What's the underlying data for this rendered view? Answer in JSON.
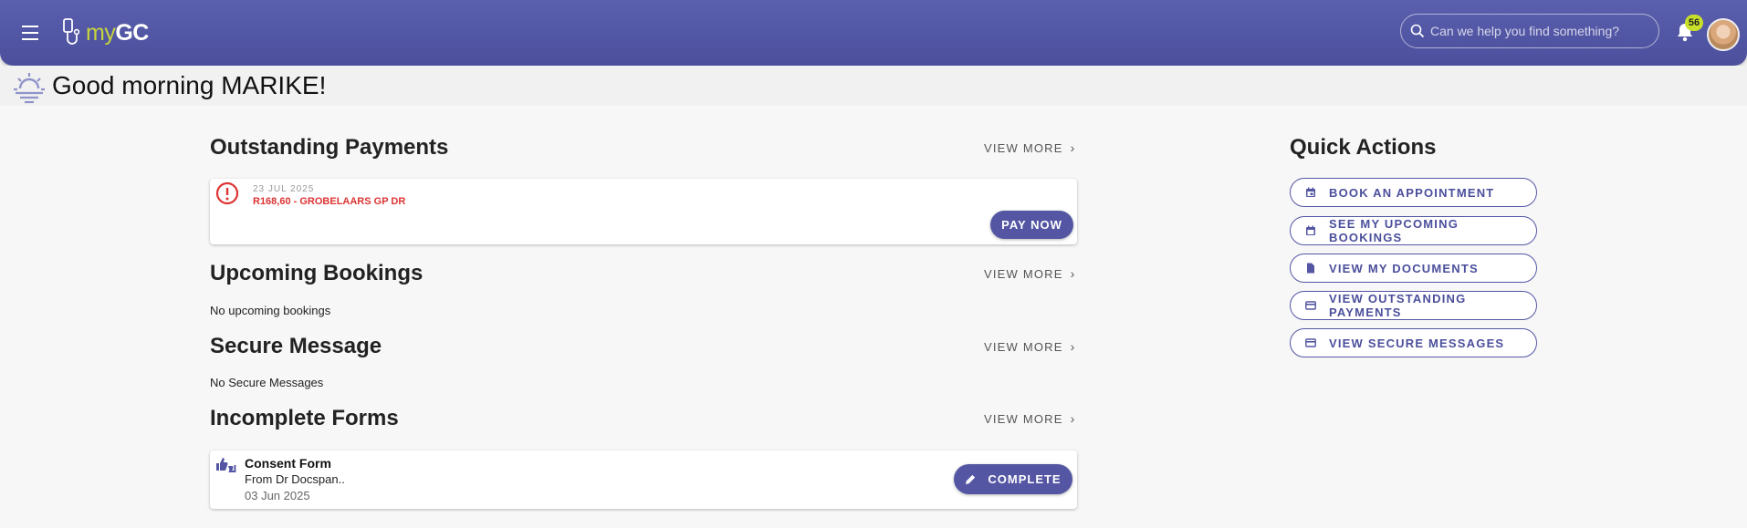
{
  "header": {
    "logo_prefix": "my",
    "logo_suffix": "GC",
    "search_placeholder": "Can we help you find something?",
    "notification_count": "56"
  },
  "greeting": "Good morning MARIKE!",
  "outstanding_payments": {
    "title": "Outstanding Payments",
    "view_more": "VIEW MORE",
    "items": [
      {
        "date": "23 JUL 2025",
        "description": "R168,60 - GROBELAARS GP DR",
        "action": "PAY NOW"
      }
    ]
  },
  "upcoming_bookings": {
    "title": "Upcoming Bookings",
    "view_more": "VIEW MORE",
    "empty": "No upcoming bookings"
  },
  "secure_message": {
    "title": "Secure Message",
    "view_more": "VIEW MORE",
    "empty": "No Secure Messages"
  },
  "incomplete_forms": {
    "title": "Incomplete Forms",
    "view_more": "VIEW MORE",
    "items": [
      {
        "title": "Consent Form",
        "from": "From Dr Docspan..",
        "date": "03 Jun 2025",
        "action": "COMPLETE"
      }
    ]
  },
  "quick_actions": {
    "title": "Quick Actions",
    "items": [
      {
        "label": "BOOK AN APPOINTMENT",
        "icon": "calendar-plus-icon"
      },
      {
        "label": "SEE MY UPCOMING BOOKINGS",
        "icon": "calendar-icon"
      },
      {
        "label": "VIEW MY DOCUMENTS",
        "icon": "document-icon"
      },
      {
        "label": "VIEW OUTSTANDING PAYMENTS",
        "icon": "credit-card-icon"
      },
      {
        "label": "VIEW SECURE MESSAGES",
        "icon": "credit-card-icon"
      }
    ]
  },
  "colors": {
    "primary": "#5456a4",
    "accent": "#c7d43a",
    "alert": "#dd3333"
  }
}
